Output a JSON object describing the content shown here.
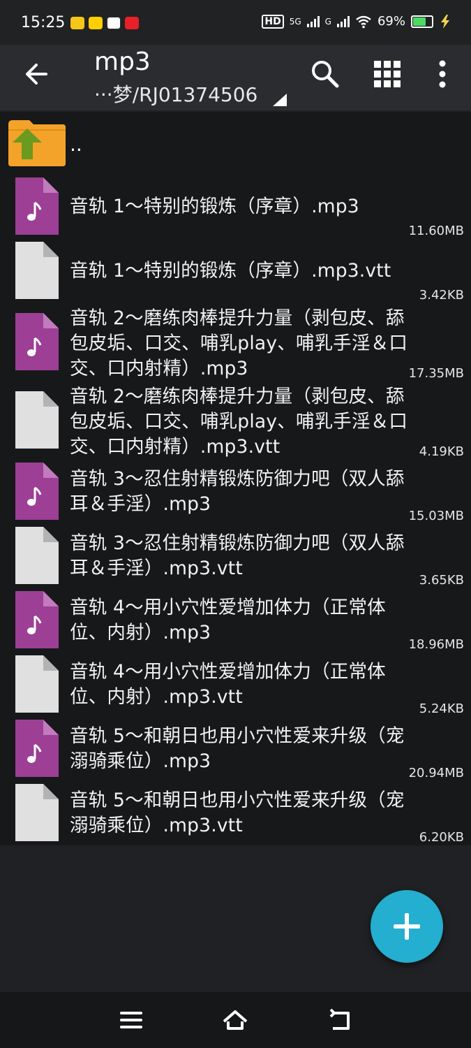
{
  "status_bar": {
    "time": "15:25",
    "hd": "HD",
    "net1": "5G",
    "net2": "G",
    "battery": "69%",
    "battery_level": 0.69,
    "notification_icons": [
      "mail-app-icon",
      "meituan-app-icon",
      "phone-manager-icon",
      "red-app-icon"
    ]
  },
  "app_bar": {
    "title": "mp3",
    "path": "···梦/RJ01374506",
    "actions": [
      "search-icon",
      "grid-view-icon",
      "more-options-icon"
    ]
  },
  "list": {
    "parent_label": "..",
    "files": [
      {
        "name": "音轨 1～特别的锻炼（序章）.mp3",
        "size": "11.60MB",
        "type": "audio"
      },
      {
        "name": "音轨 1～特别的锻炼（序章）.mp3.vtt",
        "size": "3.42KB",
        "type": "file"
      },
      {
        "name": "音轨 2～磨练肉棒提升力量（剥包皮、舔包皮垢、口交、哺乳play、哺乳手淫＆口交、口内射精）.mp3",
        "size": "17.35MB",
        "type": "audio"
      },
      {
        "name": "音轨 2～磨练肉棒提升力量（剥包皮、舔包皮垢、口交、哺乳play、哺乳手淫＆口交、口内射精）.mp3.vtt",
        "size": "4.19KB",
        "type": "file"
      },
      {
        "name": "音轨 3～忍住射精锻炼防御力吧（双人舔耳＆手淫）.mp3",
        "size": "15.03MB",
        "type": "audio"
      },
      {
        "name": "音轨 3～忍住射精锻炼防御力吧（双人舔耳＆手淫）.mp3.vtt",
        "size": "3.65KB",
        "type": "file"
      },
      {
        "name": "音轨 4～用小穴性爱增加体力（正常体位、内射）.mp3",
        "size": "18.96MB",
        "type": "audio"
      },
      {
        "name": "音轨 4～用小穴性爱增加体力（正常体位、内射）.mp3.vtt",
        "size": "5.24KB",
        "type": "file"
      },
      {
        "name": "音轨 5～和朝日也用小穴性爱来升级（宠溺骑乘位）.mp3",
        "size": "20.94MB",
        "type": "audio"
      },
      {
        "name": "音轨 5～和朝日也用小穴性爱来升级（宠溺骑乘位）.mp3.vtt",
        "size": "6.20KB",
        "type": "file"
      }
    ]
  },
  "colors": {
    "audio_icon": "#9c3f95",
    "file_icon": "#e0e0e0",
    "folder": "#f3a32a",
    "up_arrow": "#6a9a1f",
    "fab": "#24aecf"
  },
  "fab": {
    "icon": "plus-icon"
  },
  "nav_bar": {
    "buttons": [
      "menu-icon",
      "home-icon",
      "back-icon"
    ]
  }
}
